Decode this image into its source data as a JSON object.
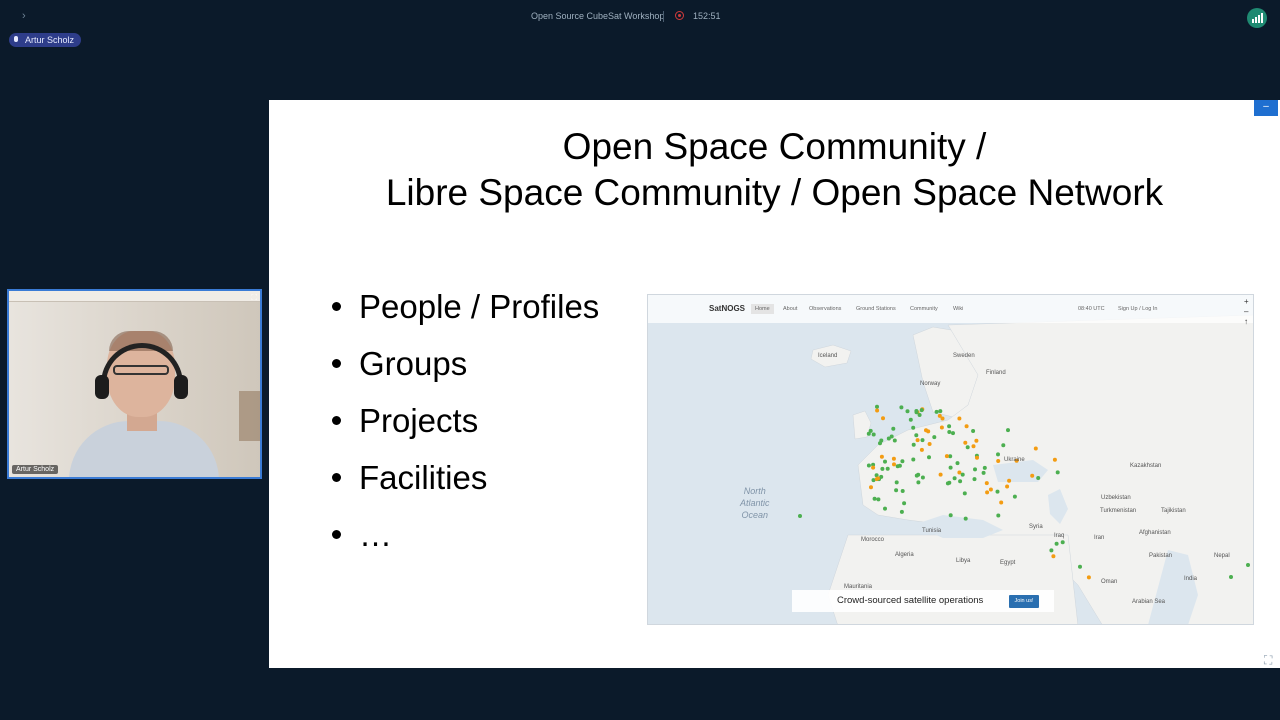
{
  "topbar": {
    "chevron": "›",
    "meeting_title": "Open Source CubeSat Workshop",
    "recording_time": "152:51",
    "signal_icon": "signal-bars-icon"
  },
  "speaker_badge": {
    "name": "Artur Scholz"
  },
  "webcam": {
    "participant_name": "Artur Scholz",
    "expand_icon": "⛶"
  },
  "slide": {
    "title_line1": "Open Space Community /",
    "title_line2": "Libre Space Community / Open Space Network",
    "bullets": [
      "People / Profiles",
      "Groups",
      "Projects",
      "Facilities",
      "…"
    ]
  },
  "panel_button": "–",
  "fullscreen_icon": "⛶",
  "map": {
    "logo": "SatNOGS",
    "logo_sub": "NETWORK",
    "nav": [
      "Home",
      "About",
      "Observations",
      "Ground Stations",
      "Community",
      "Wiki"
    ],
    "time": "08:40 UTC",
    "auth": "Sign Up / Log In",
    "zoom_controls": [
      "+",
      "–",
      "↑"
    ],
    "ocean_label": [
      "North",
      "Atlantic",
      "Ocean"
    ],
    "places": [
      "Iceland",
      "Sweden",
      "Finland",
      "Norway",
      "Ukraine",
      "Kazakhstan",
      "Uzbekistan",
      "Turkmenistan",
      "Tajikistan",
      "Afghanistan",
      "Pakistan",
      "Nepal",
      "India",
      "Iran",
      "Iraq",
      "Syria",
      "Oman",
      "Egypt",
      "Libya",
      "Algeria",
      "Tunisia",
      "Morocco",
      "Mauritania",
      "Arabian Sea"
    ],
    "banner_text": "Crowd-sourced satellite operations",
    "join_button": "Join us!",
    "colors": {
      "green": "#4caf50",
      "orange": "#f39c12",
      "sea": "#dce6ee",
      "land": "#f2f2f0"
    }
  }
}
